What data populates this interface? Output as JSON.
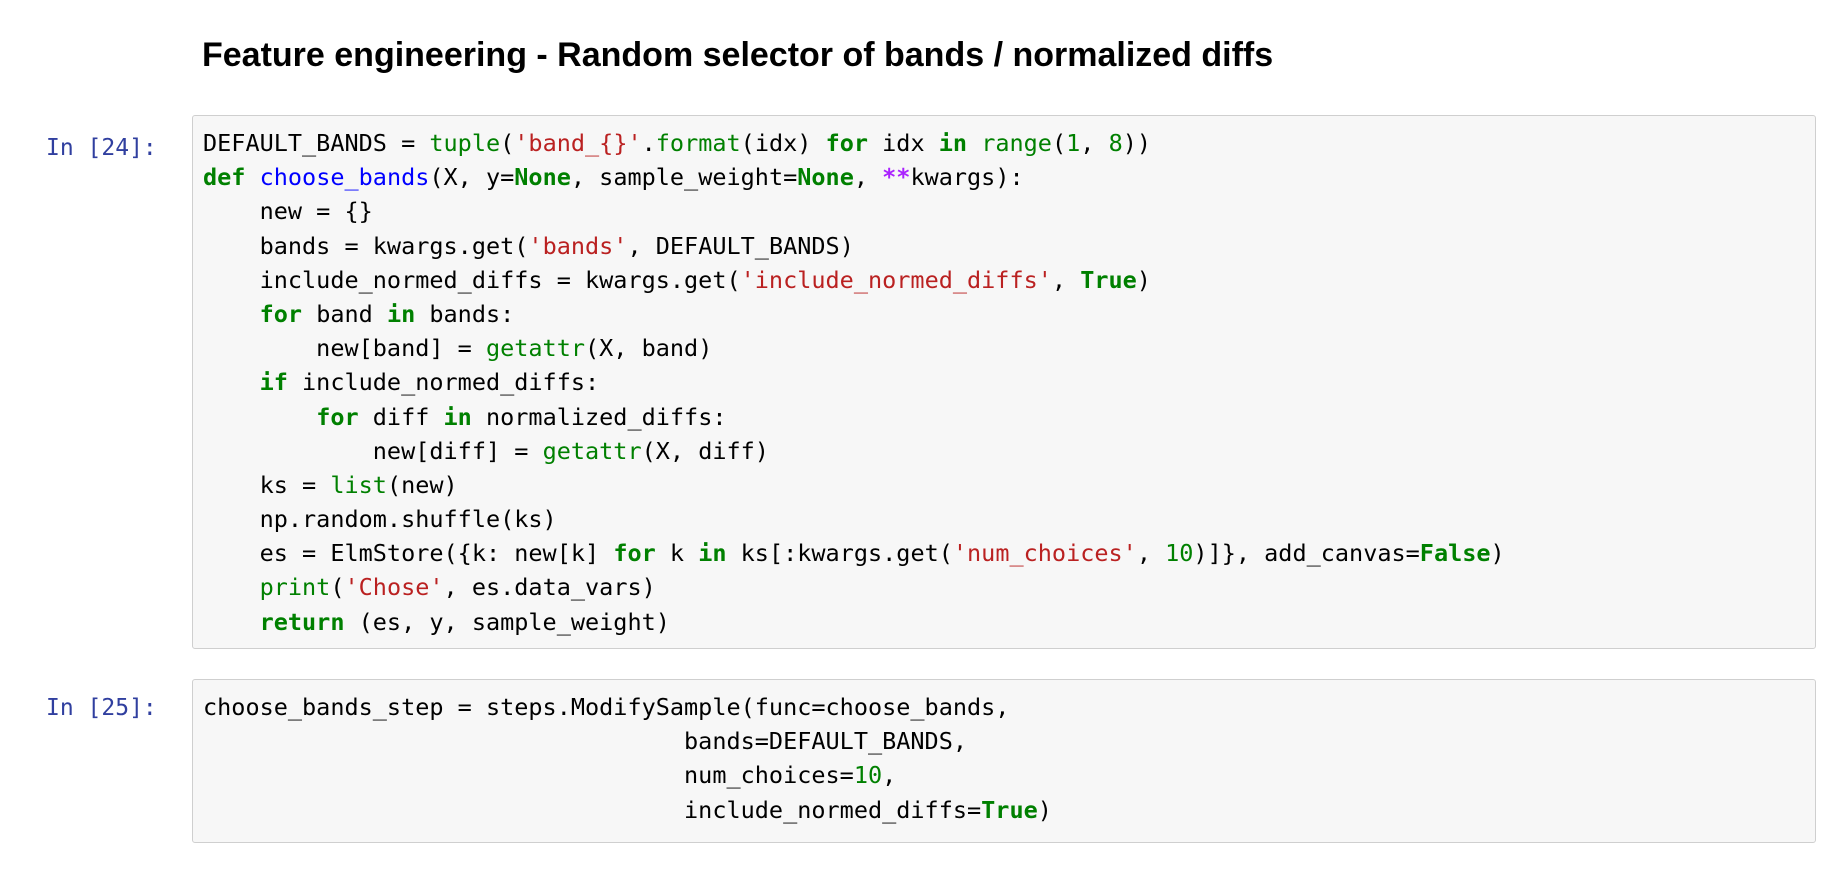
{
  "heading": "Feature engineering - Random selector of bands / normalized diffs",
  "cells": [
    {
      "prompt": "In [24]:",
      "lines": [
        [
          [
            "tx",
            "DEFAULT_BANDS = "
          ],
          [
            "bi",
            "tuple"
          ],
          [
            "tx",
            "("
          ],
          [
            "str",
            "'band_{}'"
          ],
          [
            "tx",
            "."
          ],
          [
            "bi",
            "format"
          ],
          [
            "tx",
            "(idx) "
          ],
          [
            "kw",
            "for"
          ],
          [
            "tx",
            " idx "
          ],
          [
            "kw",
            "in"
          ],
          [
            "tx",
            " "
          ],
          [
            "bi",
            "range"
          ],
          [
            "tx",
            "("
          ],
          [
            "num",
            "1"
          ],
          [
            "tx",
            ", "
          ],
          [
            "num",
            "8"
          ],
          [
            "tx",
            "))"
          ]
        ],
        [
          [
            "kw",
            "def"
          ],
          [
            "tx",
            " "
          ],
          [
            "fn",
            "choose_bands"
          ],
          [
            "tx",
            "(X, y="
          ],
          [
            "kw",
            "None"
          ],
          [
            "tx",
            ", sample_weight="
          ],
          [
            "kw",
            "None"
          ],
          [
            "tx",
            ", "
          ],
          [
            "op",
            "**"
          ],
          [
            "tx",
            "kwargs):"
          ]
        ],
        [
          [
            "tx",
            "    new = {}"
          ]
        ],
        [
          [
            "tx",
            "    bands = kwargs.get("
          ],
          [
            "str",
            "'bands'"
          ],
          [
            "tx",
            ", DEFAULT_BANDS)"
          ]
        ],
        [
          [
            "tx",
            "    include_normed_diffs = kwargs.get("
          ],
          [
            "str",
            "'include_normed_diffs'"
          ],
          [
            "tx",
            ", "
          ],
          [
            "kw",
            "True"
          ],
          [
            "tx",
            ")"
          ]
        ],
        [
          [
            "tx",
            "    "
          ],
          [
            "kw",
            "for"
          ],
          [
            "tx",
            " band "
          ],
          [
            "kw",
            "in"
          ],
          [
            "tx",
            " bands:"
          ]
        ],
        [
          [
            "tx",
            "        new[band] = "
          ],
          [
            "bi",
            "getattr"
          ],
          [
            "tx",
            "(X, band)"
          ]
        ],
        [
          [
            "tx",
            "    "
          ],
          [
            "kw",
            "if"
          ],
          [
            "tx",
            " include_normed_diffs:"
          ]
        ],
        [
          [
            "tx",
            "        "
          ],
          [
            "kw",
            "for"
          ],
          [
            "tx",
            " diff "
          ],
          [
            "kw",
            "in"
          ],
          [
            "tx",
            " normalized_diffs:"
          ]
        ],
        [
          [
            "tx",
            "            new[diff] = "
          ],
          [
            "bi",
            "getattr"
          ],
          [
            "tx",
            "(X, diff)"
          ]
        ],
        [
          [
            "tx",
            "    ks = "
          ],
          [
            "bi",
            "list"
          ],
          [
            "tx",
            "(new)"
          ]
        ],
        [
          [
            "tx",
            "    np.random.shuffle(ks)"
          ]
        ],
        [
          [
            "tx",
            "    es = ElmStore({k: new[k] "
          ],
          [
            "kw",
            "for"
          ],
          [
            "tx",
            " k "
          ],
          [
            "kw",
            "in"
          ],
          [
            "tx",
            " ks[:kwargs.get("
          ],
          [
            "str",
            "'num_choices'"
          ],
          [
            "tx",
            ", "
          ],
          [
            "num",
            "10"
          ],
          [
            "tx",
            ")]}, add_canvas="
          ],
          [
            "kw",
            "False"
          ],
          [
            "tx",
            ")"
          ]
        ],
        [
          [
            "tx",
            "    "
          ],
          [
            "bi",
            "print"
          ],
          [
            "tx",
            "("
          ],
          [
            "str",
            "'Chose'"
          ],
          [
            "tx",
            ", es.data_vars)"
          ]
        ],
        [
          [
            "tx",
            "    "
          ],
          [
            "kw",
            "return"
          ],
          [
            "tx",
            " (es, y, sample_weight)"
          ]
        ]
      ]
    },
    {
      "prompt": "In [25]:",
      "lines": [
        [
          [
            "tx",
            "choose_bands_step = steps.ModifySample(func=choose_bands,"
          ]
        ],
        [
          [
            "tx",
            "                                  bands=DEFAULT_BANDS,"
          ]
        ],
        [
          [
            "tx",
            "                                  num_choices="
          ],
          [
            "num",
            "10"
          ],
          [
            "tx",
            ","
          ]
        ],
        [
          [
            "tx",
            "                                  include_normed_diffs="
          ],
          [
            "kw",
            "True"
          ],
          [
            "tx",
            ")"
          ]
        ]
      ]
    }
  ]
}
